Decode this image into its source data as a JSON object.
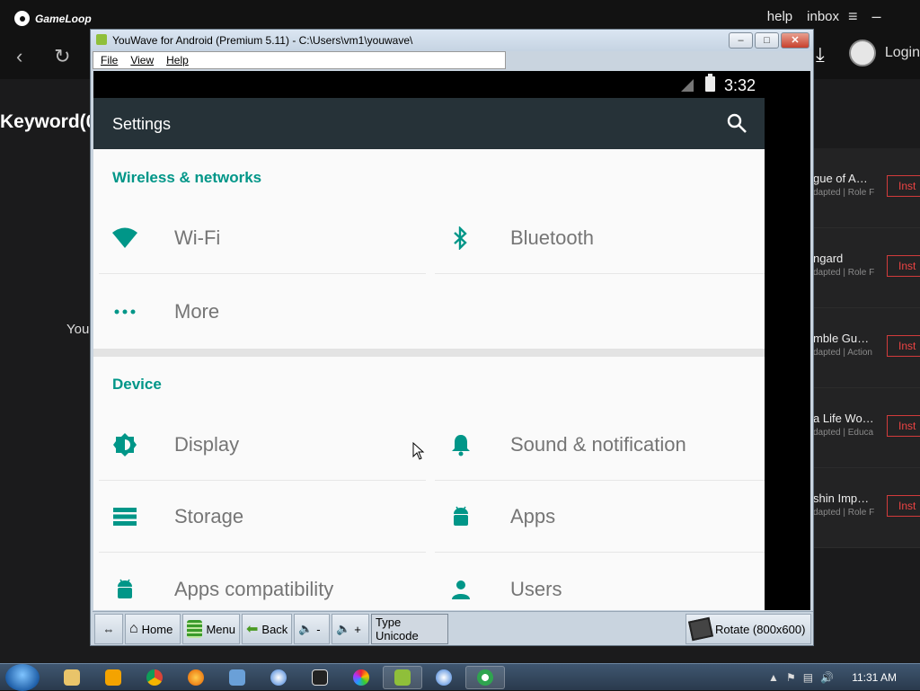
{
  "gameloop": {
    "logo": "GameLoop",
    "links": [
      "help",
      "inbox"
    ],
    "login": "Login",
    "keyword": "Keyword(0",
    "you": "You",
    "results": [
      {
        "title": "gue of A…",
        "sub": "dapted | Role F",
        "btn": "Inst"
      },
      {
        "title": "ngard",
        "sub": "dapted | Role F",
        "btn": "Inst"
      },
      {
        "title": "mble Gu…",
        "sub": "dapted | Action",
        "btn": "Inst"
      },
      {
        "title": "a Life Wo…",
        "sub": "dapted | Educa",
        "btn": "Inst"
      },
      {
        "title": "shin Imp…",
        "sub": "dapted | Role F",
        "btn": "Inst"
      }
    ]
  },
  "window": {
    "title": "YouWave for Android (Premium 5.11) - C:\\Users\\vm1\\youwave\\",
    "menu": [
      "File",
      "View",
      "Help"
    ]
  },
  "android": {
    "time": "3:32",
    "appbar_title": "Settings",
    "section_wireless": "Wireless & networks",
    "section_device": "Device",
    "items": {
      "wifi": "Wi-Fi",
      "bluetooth": "Bluetooth",
      "more": "More",
      "display": "Display",
      "sound": "Sound & notification",
      "storage": "Storage",
      "apps": "Apps",
      "apps_compat": "Apps compatibility",
      "users": "Users"
    }
  },
  "toolbar": {
    "home": "Home",
    "menu": "Menu",
    "back": "Back",
    "vol_down": "-",
    "vol_up": "+",
    "type_unicode": "Type Unicode",
    "rotate": "Rotate (800x600)"
  },
  "taskbar": {
    "clock": "11:31 AM"
  },
  "colors": {
    "accent": "#009688",
    "appbar": "#263238",
    "install_red": "#d23b3b"
  }
}
